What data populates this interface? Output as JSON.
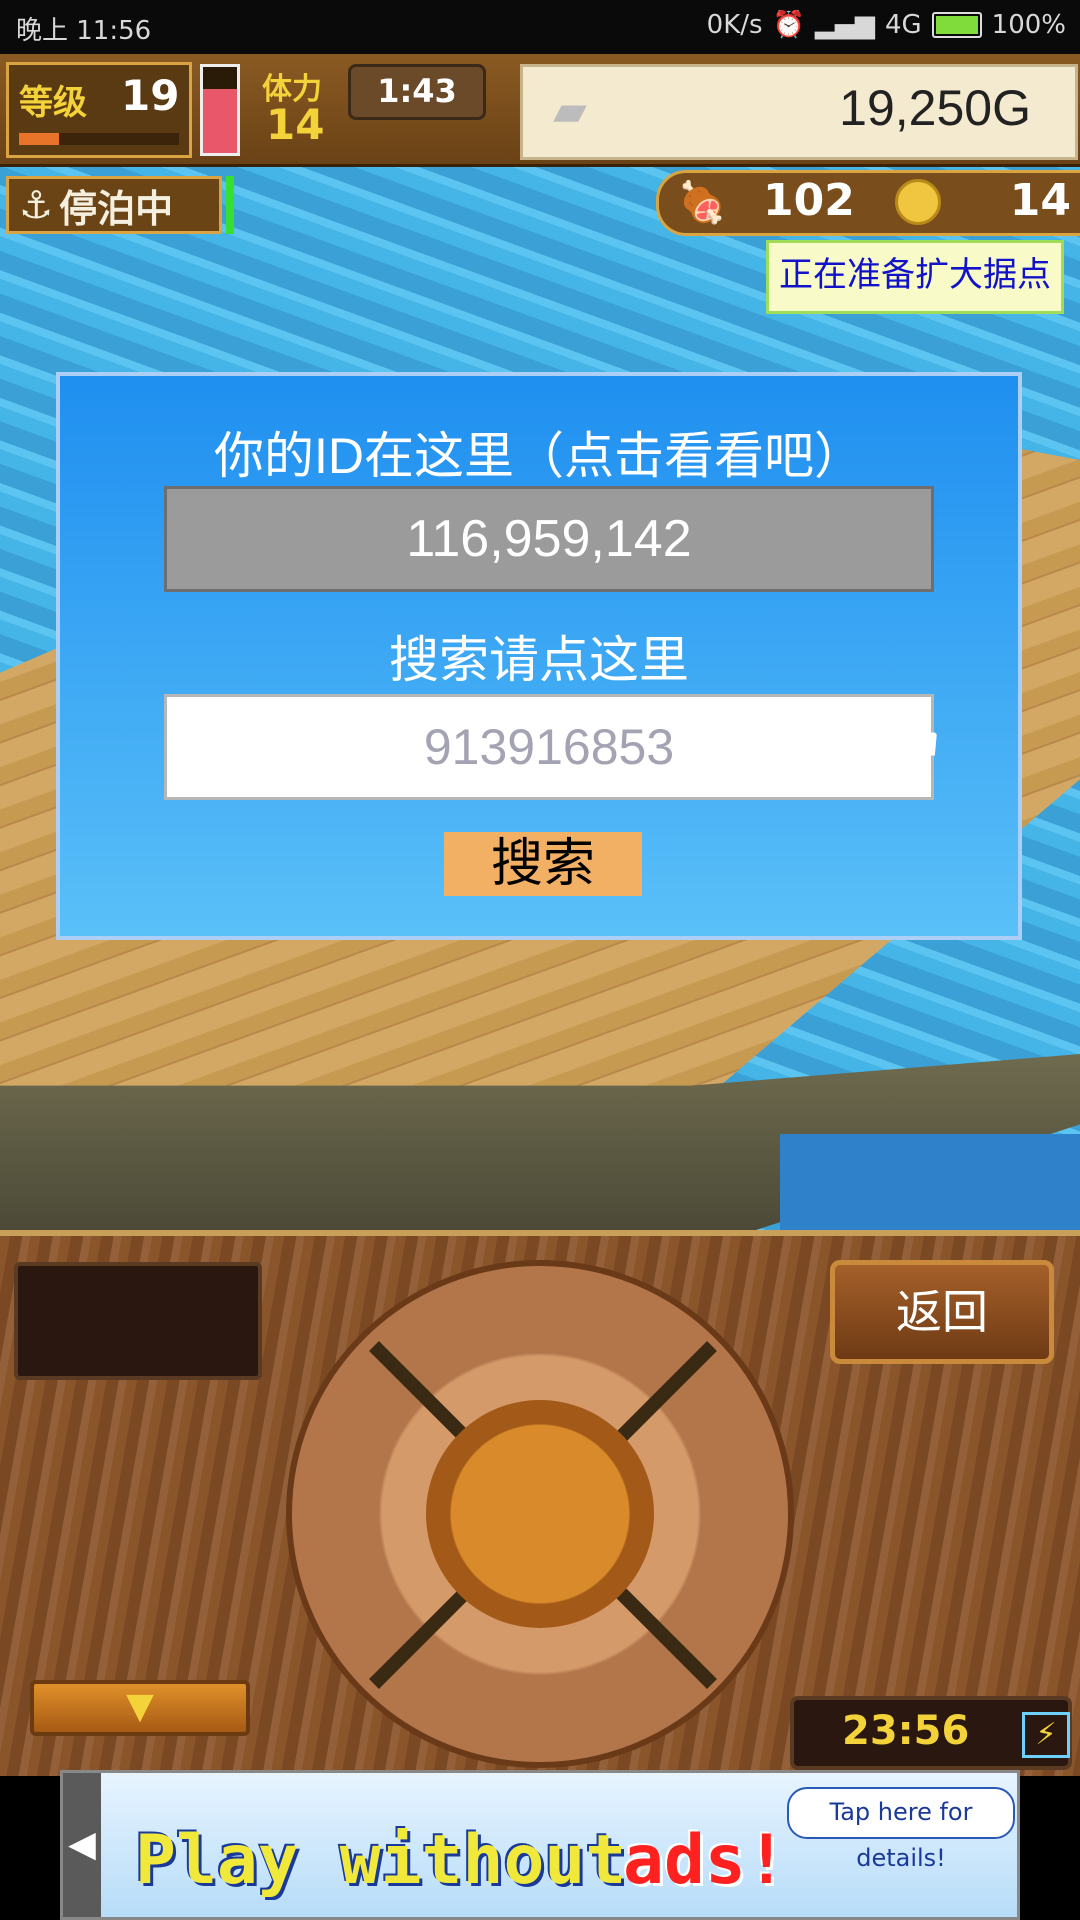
{
  "status_bar": {
    "time": "晚上 11:56",
    "net_speed": "0K/s",
    "network": "4G",
    "battery": "100%"
  },
  "hud": {
    "level_label": "等级",
    "level": "19",
    "level_progress": 0.25,
    "stamina_label": "体力",
    "stamina": "14",
    "stamina_level": 0.75,
    "timer": "1:43",
    "money": "19,250G",
    "dock_status": "停泊中",
    "food": "102",
    "coins": "14",
    "expand_notice": "正在准备扩大据点"
  },
  "dialog": {
    "title": "你的ID在这里（点击看看吧）",
    "user_id": "116,959,142",
    "search_prompt": "搜索请点这里",
    "search_value": "913916853",
    "search_button": "搜索"
  },
  "controls": {
    "back_button": "返回",
    "down_button": "▼",
    "clock": "23:56",
    "charge_icon": "⚡"
  },
  "ad": {
    "text_part1": "Play without",
    "text_part2": "ads!",
    "tip": "Tap here for details!",
    "arrow": "◀"
  }
}
